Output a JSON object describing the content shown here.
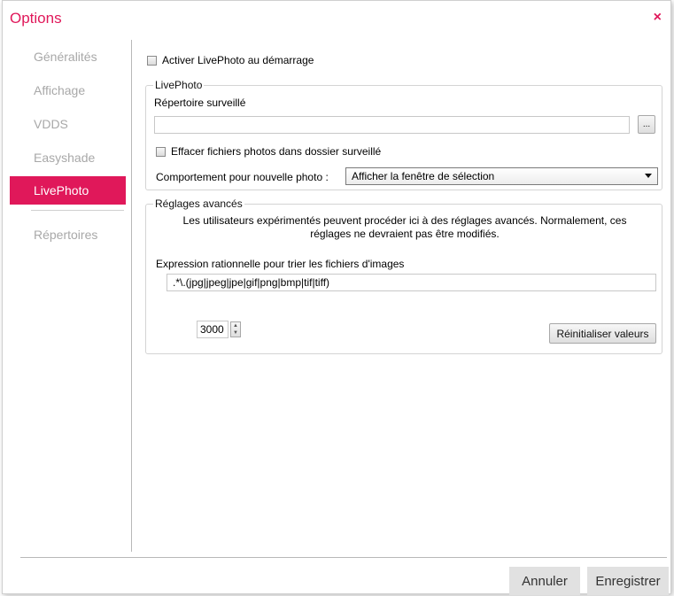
{
  "window": {
    "title": "Options",
    "close_glyph": "×"
  },
  "sidebar": {
    "items": [
      {
        "label": "Généralités"
      },
      {
        "label": "Affichage"
      },
      {
        "label": "VDDS"
      },
      {
        "label": "Easyshade"
      },
      {
        "label": "LivePhoto",
        "active": true
      },
      {
        "label": "Répertoires"
      }
    ]
  },
  "main": {
    "activate_label": "Activer LivePhoto au démarrage",
    "livephoto_group": {
      "legend": "LivePhoto",
      "watched_dir_label": "Répertoire  surveillé",
      "watched_dir_value": "",
      "browse_label": "...",
      "delete_label": "Effacer fichiers photos dans dossier surveillé",
      "behavior_label": "Comportement pour nouvelle photo :",
      "behavior_value": "Afficher la fenêtre de sélection"
    },
    "advanced_group": {
      "legend": "Réglages avancés",
      "description": "Les utilisateurs expérimentés peuvent procéder ici à des réglages avancés. Normalement, ces réglages ne devraient pas être modifiés.",
      "regex_label": "Expression rationnelle pour trier les fichiers d'images",
      "regex_value": ".*\\.(jpg|jpeg|jpe|gif|png|bmp|tif|tiff)",
      "spin_value": "3000",
      "reset_label": "Réinitialiser valeurs"
    }
  },
  "footer": {
    "cancel_label": "Annuler",
    "save_label": "Enregistrer"
  },
  "colors": {
    "accent": "#e0185a",
    "inactive_nav": "#a8a8a8"
  }
}
